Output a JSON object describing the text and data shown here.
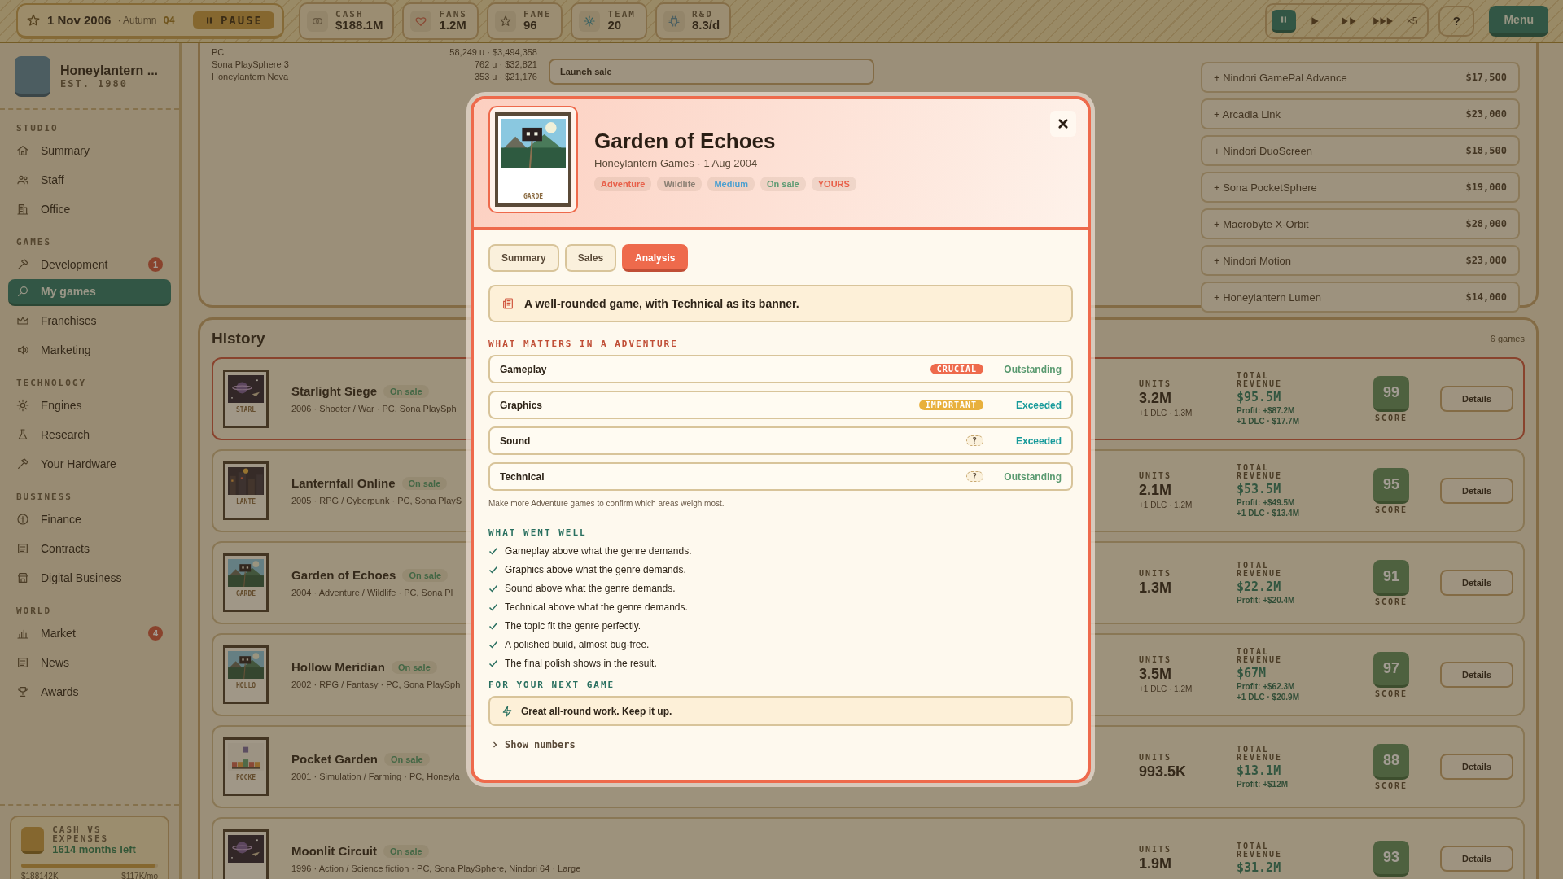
{
  "top_bar": {
    "date": "1 Nov 2006",
    "season": "· Autumn",
    "quarter": "Q4",
    "pause_button": "PAUSE",
    "stats": [
      {
        "kind": "coins",
        "label": "CASH",
        "value": "$188.1M"
      },
      {
        "kind": "heart",
        "label": "FANS",
        "value": "1.2M"
      },
      {
        "kind": "star",
        "label": "FAME",
        "value": "96"
      },
      {
        "kind": "gear",
        "label": "TEAM",
        "value": "20"
      },
      {
        "kind": "chip",
        "label": "R&D",
        "value": "8.3/d"
      }
    ],
    "speed_controls": [
      {
        "kind": "pause",
        "selected": true
      },
      {
        "kind": "play",
        "selected": false
      },
      {
        "kind": "fast",
        "selected": false
      },
      {
        "kind": "fastest",
        "selected": false
      }
    ],
    "speed_multiplier": "×5",
    "help_button": "?",
    "menu_button": "Menu"
  },
  "sidebar": {
    "studio_name": "Honeylantern ...",
    "established": "EST. 1980",
    "sections": [
      {
        "title": "STUDIO",
        "items": [
          {
            "kind": "home",
            "label": "Summary",
            "selected": false
          },
          {
            "kind": "people",
            "label": "Staff",
            "selected": false
          },
          {
            "kind": "building",
            "label": "Office",
            "selected": false
          }
        ]
      },
      {
        "title": "GAMES",
        "items": [
          {
            "kind": "hammer",
            "label": "Development",
            "selected": false,
            "badge": "1"
          },
          {
            "kind": "search",
            "label": "My games",
            "selected": true
          },
          {
            "kind": "crown",
            "label": "Franchises",
            "selected": false
          },
          {
            "kind": "speaker",
            "label": "Marketing",
            "selected": false
          }
        ]
      },
      {
        "title": "TECHNOLOGY",
        "items": [
          {
            "kind": "sun",
            "label": "Engines",
            "selected": false
          },
          {
            "kind": "flask",
            "label": "Research",
            "selected": false
          },
          {
            "kind": "hammer",
            "label": "Your Hardware",
            "selected": false
          }
        ]
      },
      {
        "title": "BUSINESS",
        "items": [
          {
            "kind": "coin",
            "label": "Finance",
            "selected": false
          },
          {
            "kind": "document",
            "label": "Contracts",
            "selected": false
          },
          {
            "kind": "store",
            "label": "Digital Business",
            "selected": false
          }
        ]
      },
      {
        "title": "WORLD",
        "items": [
          {
            "kind": "chart",
            "label": "Market",
            "selected": false,
            "badge": "4"
          },
          {
            "kind": "document",
            "label": "News",
            "selected": false
          },
          {
            "kind": "trophy",
            "label": "Awards",
            "selected": false
          }
        ]
      }
    ],
    "cash_card": {
      "title": "CASH VS EXPENSES",
      "subtitle": "1614 months left",
      "level": 0.98,
      "cash": "$188142K",
      "burn": "-$117K/mo"
    }
  },
  "sales_panel": {
    "platform_sales": [
      {
        "platform": "PC",
        "figures": "58,249 u · $3,494,358"
      },
      {
        "platform": "Sona PlaySphere 3",
        "figures": "762 u · $32,821"
      },
      {
        "platform": "Honeylantern Nova",
        "figures": "353 u · $21,176"
      }
    ],
    "launch_sale_button": "Launch sale",
    "platform_options": [
      {
        "label": "+ Nindori GamePal Advance",
        "price": "$17,500"
      },
      {
        "label": "+ Arcadia Link",
        "price": "$23,000"
      },
      {
        "label": "+ Nindori DuoScreen",
        "price": "$18,500"
      },
      {
        "label": "+ Sona PocketSphere",
        "price": "$19,000"
      },
      {
        "label": "+ Macrobyte X-Orbit",
        "price": "$28,000"
      },
      {
        "label": "+ Nindori Motion",
        "price": "$23,000"
      },
      {
        "label": "+ Honeylantern Lumen",
        "price": "$14,000"
      }
    ]
  },
  "history": {
    "title": "History",
    "count": "6 games",
    "games": [
      {
        "cover_label": "STARL",
        "title": "Starlight Siege",
        "status": "On sale",
        "meta": "2006 · Shooter / War · PC, Sona PlaySph",
        "selected": true,
        "units_label": "UNITS",
        "units": "3.2M",
        "units_note": "+1 DLC · 1.3M",
        "revenue_label": "TOTAL REVENUE",
        "revenue": "$95.5M",
        "profit": "Profit: +$87.2M",
        "dlc_revenue": "+1 DLC · $17.7M",
        "score": "99",
        "score_label": "SCORE",
        "details_button": "Details"
      },
      {
        "cover_label": "LANTE",
        "title": "Lanternfall Online",
        "status": "On sale",
        "meta": "2005 · RPG / Cyberpunk · PC, Sona PlayS",
        "selected": false,
        "units_label": "UNITS",
        "units": "2.1M",
        "units_note": "+1 DLC · 1.2M",
        "revenue_label": "TOTAL REVENUE",
        "revenue": "$53.5M",
        "profit": "Profit: +$49.5M",
        "dlc_revenue": "+1 DLC · $13.4M",
        "score": "95",
        "score_label": "SCORE",
        "details_button": "Details"
      },
      {
        "cover_label": "GARDE",
        "title": "Garden of Echoes",
        "status": "On sale",
        "meta": "2004 · Adventure / Wildlife · PC, Sona Pl",
        "selected": false,
        "units_label": "UNITS",
        "units": "1.3M",
        "revenue_label": "TOTAL REVENUE",
        "revenue": "$22.2M",
        "profit": "Profit: +$20.4M",
        "score": "91",
        "score_label": "SCORE",
        "details_button": "Details"
      },
      {
        "cover_label": "HOLLO",
        "title": "Hollow Meridian",
        "status": "On sale",
        "meta": "2002 · RPG / Fantasy · PC, Sona PlaySph",
        "selected": false,
        "units_label": "UNITS",
        "units": "3.5M",
        "units_note": "+1 DLC · 1.2M",
        "revenue_label": "TOTAL REVENUE",
        "revenue": "$67M",
        "profit": "Profit: +$62.3M",
        "dlc_revenue": "+1 DLC · $20.9M",
        "score": "97",
        "score_label": "SCORE",
        "details_button": "Details"
      },
      {
        "cover_label": "POCKE",
        "title": "Pocket Garden",
        "status": "On sale",
        "meta": "2001 · Simulation / Farming · PC, Honeyla",
        "selected": false,
        "units_label": "UNITS",
        "units": "993.5K",
        "revenue_label": "TOTAL REVENUE",
        "revenue": "$13.1M",
        "profit": "Profit: +$12M",
        "score": "88",
        "score_label": "SCORE",
        "details_button": "Details"
      },
      {
        "title": "Moonlit Circuit",
        "status": "On sale",
        "meta": "1996 · Action / Science fiction · PC, Sona PlaySphere, Nindori 64 · Large",
        "selected": false,
        "units_label": "UNITS",
        "units": "1.9M",
        "revenue_label": "TOTAL REVENUE",
        "revenue": "$31.2M",
        "score": "93",
        "details_button": "Details"
      }
    ]
  },
  "modal": {
    "cover_label": "GARDE",
    "title": "Garden of Echoes",
    "subtitle": "Honeylantern Games · 1 Aug 2004",
    "tags": [
      {
        "label": "Adventure",
        "color": "#e8604a"
      },
      {
        "label": "Wildlife",
        "color": "#8a7f73"
      },
      {
        "label": "Medium",
        "color": "#4a9fd0"
      },
      {
        "label": "On sale",
        "color": "#5b9a72"
      },
      {
        "label": "YOURS",
        "color": "#e8604a"
      }
    ],
    "tabs": [
      {
        "label": "Summary",
        "selected": false
      },
      {
        "label": "Sales",
        "selected": false
      },
      {
        "label": "Analysis",
        "selected": true
      }
    ],
    "verdict": "A well-rounded game, with Technical as its banner.",
    "matters_heading": "WHAT MATTERS IN A ADVENTURE",
    "factors": [
      {
        "name": "Gameplay",
        "weight": {
          "kind": "crucial",
          "label": "CRUCIAL"
        },
        "result": {
          "kind": "outstanding",
          "label": "Outstanding"
        }
      },
      {
        "name": "Graphics",
        "weight": {
          "kind": "important",
          "label": "IMPORTANT"
        },
        "result": {
          "kind": "exceeded",
          "label": "Exceeded"
        }
      },
      {
        "name": "Sound",
        "weight": {
          "kind": "unknown",
          "label": "?"
        },
        "result": {
          "kind": "exceeded",
          "label": "Exceeded"
        }
      },
      {
        "name": "Technical",
        "weight": {
          "kind": "unknown",
          "label": "?"
        },
        "result": {
          "kind": "outstanding",
          "label": "Outstanding"
        }
      }
    ],
    "note": "Make more Adventure games to confirm which areas weigh most.",
    "went_well_heading": "WHAT WENT WELL",
    "went_well": [
      "Gameplay above what the genre demands.",
      "Graphics above what the genre demands.",
      "Sound above what the genre demands.",
      "Technical above what the genre demands.",
      "The topic fit the genre perfectly.",
      "A polished build, almost bug-free.",
      "The final polish shows in the result."
    ],
    "next_heading": "FOR YOUR NEXT GAME",
    "tip": "Great all-round work. Keep it up.",
    "show_numbers": "Show numbers"
  }
}
